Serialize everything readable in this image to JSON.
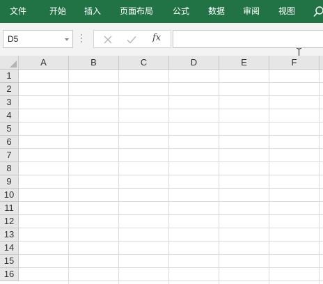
{
  "ribbon": {
    "tabs": [
      "文件",
      "开始",
      "插入",
      "页面布局",
      "公式",
      "数据",
      "审阅",
      "视图"
    ],
    "search_icon": "search-icon"
  },
  "formula_bar": {
    "name_box_value": "D5",
    "cancel_icon": "close-icon",
    "enter_icon": "checkmark-icon",
    "fx_label": "fx",
    "formula_value": ""
  },
  "sheet": {
    "columns": [
      "A",
      "B",
      "C",
      "D",
      "E",
      "F"
    ],
    "rows": [
      "1",
      "2",
      "3",
      "4",
      "5",
      "6",
      "7",
      "8",
      "9",
      "10",
      "11",
      "12",
      "13",
      "14",
      "15",
      "16"
    ]
  },
  "colors": {
    "ribbon": "#217346",
    "header_bg": "#e6e6e6",
    "gridline": "#dadada"
  }
}
